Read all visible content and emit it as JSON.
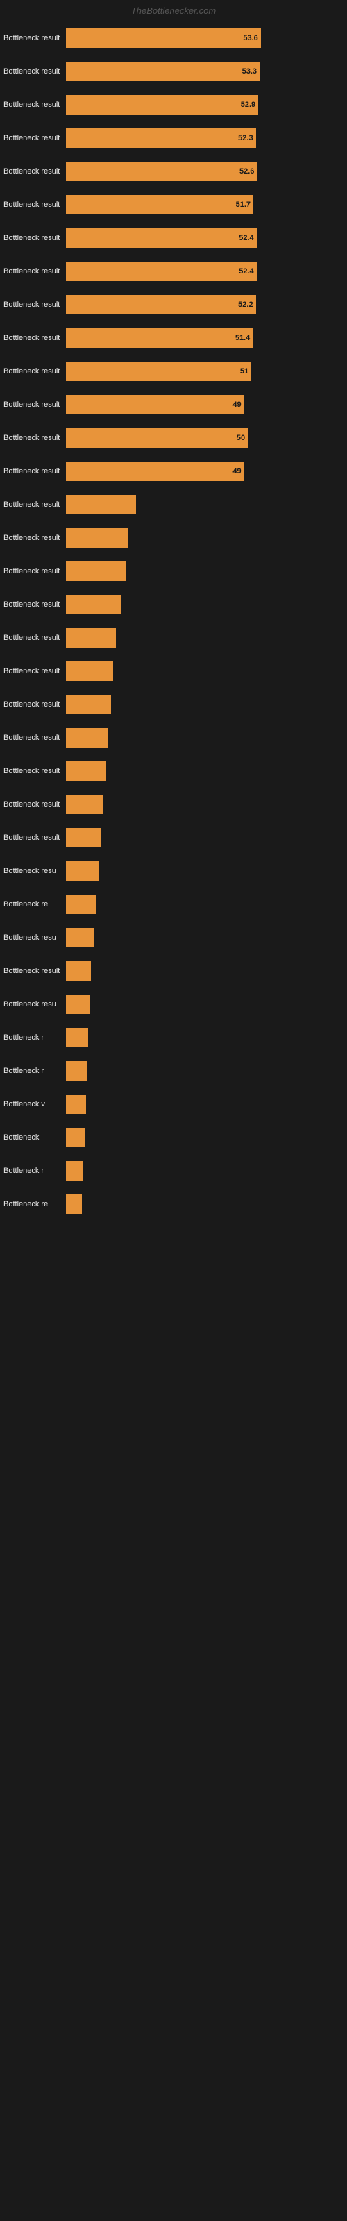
{
  "header": {
    "title": "TheBottlenecker.com"
  },
  "bars": [
    {
      "label": "Bottleneck result",
      "value": 53.6,
      "width_pct": 78
    },
    {
      "label": "Bottleneck result",
      "value": 53.3,
      "width_pct": 77.5
    },
    {
      "label": "Bottleneck result",
      "value": 52.9,
      "width_pct": 77
    },
    {
      "label": "Bottleneck result",
      "value": 52.3,
      "width_pct": 76
    },
    {
      "label": "Bottleneck result",
      "value": 52.6,
      "width_pct": 76.5
    },
    {
      "label": "Bottleneck result",
      "value": 51.7,
      "width_pct": 75
    },
    {
      "label": "Bottleneck result",
      "value": 52.4,
      "width_pct": 76.3
    },
    {
      "label": "Bottleneck result",
      "value": 52.4,
      "width_pct": 76.3
    },
    {
      "label": "Bottleneck result",
      "value": 52.2,
      "width_pct": 76
    },
    {
      "label": "Bottleneck result",
      "value": 51.4,
      "width_pct": 74.8
    },
    {
      "label": "Bottleneck result",
      "value": 51,
      "width_pct": 74.2
    },
    {
      "label": "Bottleneck result",
      "value": 49,
      "width_pct": 71.3
    },
    {
      "label": "Bottleneck result",
      "value": 50,
      "width_pct": 72.8
    },
    {
      "label": "Bottleneck result",
      "value": 49,
      "width_pct": 71.3
    },
    {
      "label": "Bottleneck result",
      "value": null,
      "width_pct": 28
    },
    {
      "label": "Bottleneck result",
      "value": null,
      "width_pct": 25
    },
    {
      "label": "Bottleneck result",
      "value": null,
      "width_pct": 24
    },
    {
      "label": "Bottleneck result",
      "value": null,
      "width_pct": 22
    },
    {
      "label": "Bottleneck result",
      "value": null,
      "width_pct": 20
    },
    {
      "label": "Bottleneck result",
      "value": null,
      "width_pct": 19
    },
    {
      "label": "Bottleneck result",
      "value": null,
      "width_pct": 18
    },
    {
      "label": "Bottleneck result",
      "value": null,
      "width_pct": 17
    },
    {
      "label": "Bottleneck result",
      "value": null,
      "width_pct": 16
    },
    {
      "label": "Bottleneck result",
      "value": null,
      "width_pct": 15
    },
    {
      "label": "Bottleneck result",
      "value": null,
      "width_pct": 14
    },
    {
      "label": "Bottleneck resu",
      "value": null,
      "width_pct": 13
    },
    {
      "label": "Bottleneck re",
      "value": null,
      "width_pct": 12
    },
    {
      "label": "Bottleneck resu",
      "value": null,
      "width_pct": 11
    },
    {
      "label": "Bottleneck result",
      "value": null,
      "width_pct": 10
    },
    {
      "label": "Bottleneck resu",
      "value": null,
      "width_pct": 9.5
    },
    {
      "label": "Bottleneck r",
      "value": null,
      "width_pct": 9
    },
    {
      "label": "Bottleneck r",
      "value": null,
      "width_pct": 8.5
    },
    {
      "label": "Bottleneck v",
      "value": null,
      "width_pct": 8
    },
    {
      "label": "Bottleneck",
      "value": null,
      "width_pct": 7.5
    },
    {
      "label": "Bottleneck r",
      "value": null,
      "width_pct": 7
    },
    {
      "label": "Bottleneck re",
      "value": null,
      "width_pct": 6.5
    }
  ]
}
